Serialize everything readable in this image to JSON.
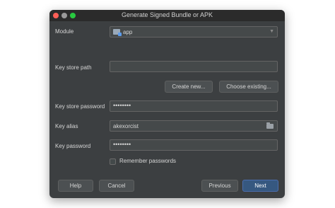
{
  "window": {
    "title": "Generate Signed Bundle or APK"
  },
  "form": {
    "module_label": "Module",
    "module_value": "app",
    "keystore_path_label": "Key store path",
    "keystore_path_value": "",
    "create_new_label": "Create new...",
    "choose_existing_label": "Choose existing...",
    "keystore_password_label": "Key store password",
    "keystore_password_value": "••••••••",
    "key_alias_label": "Key alias",
    "key_alias_value": "akexorcist",
    "key_password_label": "Key password",
    "key_password_value": "••••••••",
    "remember_label": "Remember passwords",
    "remember_checked": false
  },
  "footer": {
    "help_label": "Help",
    "cancel_label": "Cancel",
    "previous_label": "Previous",
    "next_label": "Next"
  },
  "icons": {
    "module": "module-icon",
    "dropdown": "chevron-down-icon",
    "folder": "folder-icon"
  }
}
